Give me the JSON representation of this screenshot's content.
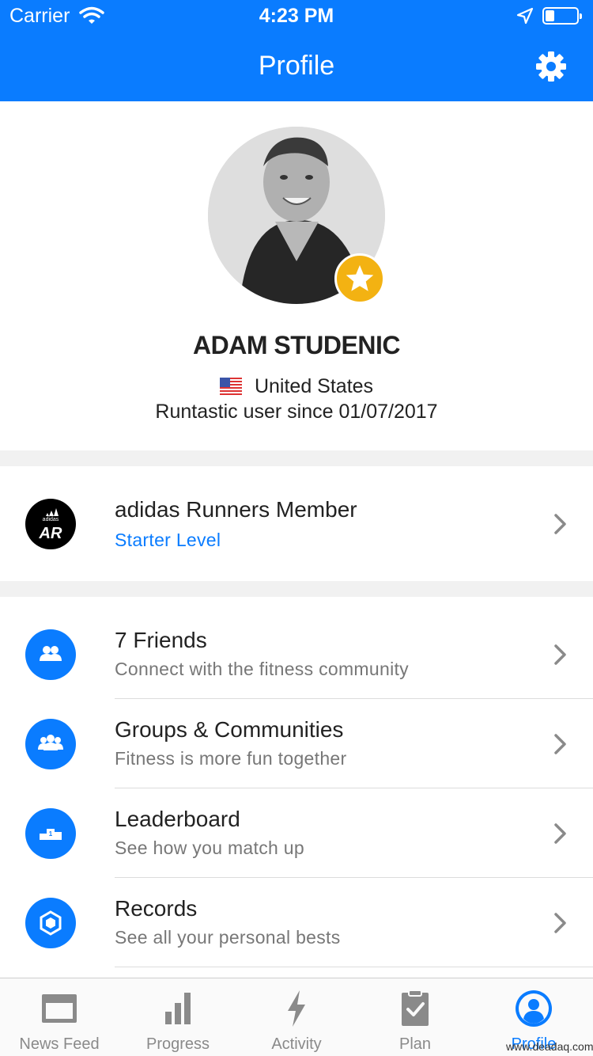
{
  "status_bar": {
    "carrier": "Carrier",
    "time": "4:23 PM",
    "battery_level": 0.3
  },
  "header": {
    "title": "Profile",
    "settings_icon": "gear-icon"
  },
  "profile": {
    "name": "ADAM STUDENIC",
    "country": "United States",
    "member_since": "Runtastic user since 01/07/2017",
    "badge_icon": "star-icon"
  },
  "membership": {
    "title": "adidas Runners Member",
    "level": "Starter Level",
    "logo_text": "AR",
    "logo_brand": "adidas"
  },
  "rows": [
    {
      "title": "7 Friends",
      "subtitle": "Connect with the fitness community",
      "icon": "friends-icon"
    },
    {
      "title": "Groups & Communities",
      "subtitle": "Fitness is more fun together",
      "icon": "groups-icon"
    },
    {
      "title": "Leaderboard",
      "subtitle": "See how you match up",
      "icon": "podium-icon"
    },
    {
      "title": "Records",
      "subtitle": "See all your personal bests",
      "icon": "records-icon"
    }
  ],
  "tabs": [
    {
      "label": "News Feed",
      "icon": "news-feed-icon"
    },
    {
      "label": "Progress",
      "icon": "progress-icon"
    },
    {
      "label": "Activity",
      "icon": "activity-icon"
    },
    {
      "label": "Plan",
      "icon": "plan-icon"
    },
    {
      "label": "Profile",
      "icon": "profile-icon",
      "active": true
    }
  ],
  "watermark": "www.deadaq.com",
  "colors": {
    "primary": "#0a7cff",
    "badge": "#f3b212",
    "separator": "#f1f1f1"
  }
}
